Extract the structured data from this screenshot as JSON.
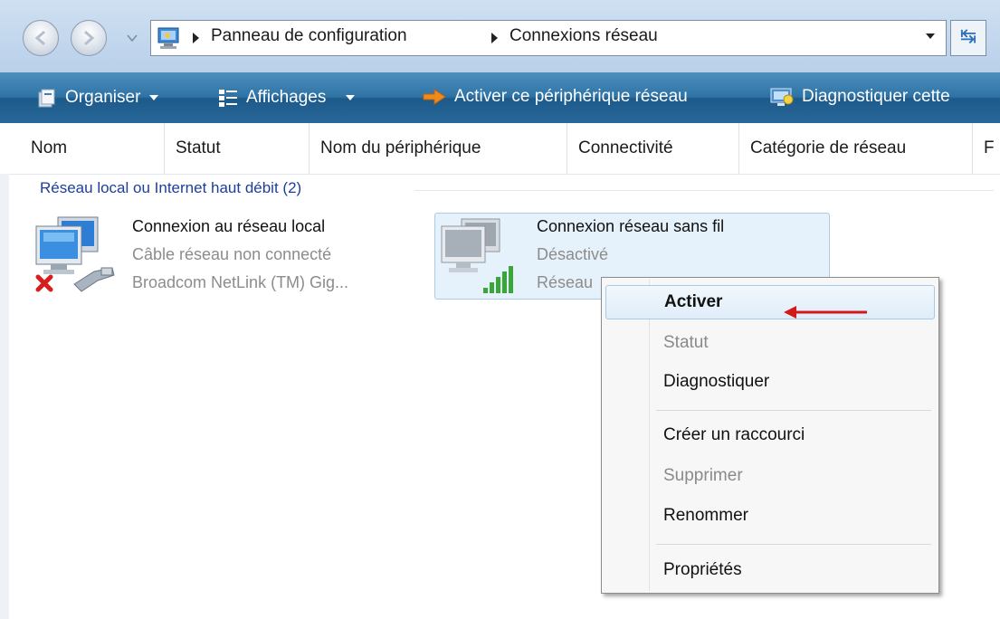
{
  "address_bar": {
    "crumbs": [
      "Panneau de configuration",
      "Connexions réseau"
    ]
  },
  "toolbar": {
    "organiser": "Organiser",
    "affichages": "Affichages",
    "activer": "Activer ce périphérique réseau",
    "diagnostiquer": "Diagnostiquer cette"
  },
  "columns": [
    "Nom",
    "Statut",
    "Nom du périphérique",
    "Connectivité",
    "Catégorie de réseau",
    "F"
  ],
  "group": {
    "title": "Réseau local ou Internet haut débit (2)"
  },
  "items": [
    {
      "name": "Connexion au réseau local",
      "status": "Câble réseau non connecté",
      "device": "Broadcom NetLink (TM) Gig...",
      "icon": "wired-network-disconnected-icon"
    },
    {
      "name": "Connexion réseau sans fil",
      "status": "Désactivé",
      "device": "Réseau",
      "icon": "wireless-network-icon"
    }
  ],
  "context_menu": {
    "items": [
      "Activer",
      "Statut",
      "Diagnostiquer",
      "Créer un raccourci",
      "Supprimer",
      "Renommer",
      "Propriétés"
    ],
    "disabled": [
      "Statut",
      "Supprimer"
    ],
    "default": "Activer"
  },
  "colors": {
    "toolbar_blue": "#2f73a6",
    "group_header": "#1e3e9c",
    "annotation_arrow": "#d11a1a",
    "selection": "#e6f2fb"
  }
}
